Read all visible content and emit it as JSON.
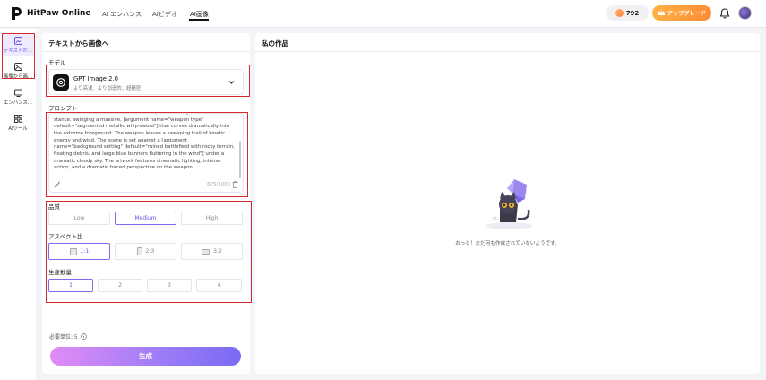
{
  "header": {
    "brand": "HitPaw Online",
    "tabs": [
      {
        "label": "AI エンハンス"
      },
      {
        "label": "AIビデオ"
      },
      {
        "label": "AI画像"
      }
    ],
    "credits": "792",
    "upgrade_label": "アップグレード"
  },
  "rail": {
    "items": [
      {
        "label": "テキストか...",
        "icon": "text-to-image-icon"
      },
      {
        "label": "画像から画...",
        "icon": "image-to-image-icon"
      },
      {
        "label": "エンハンス...",
        "icon": "enhance-icon"
      },
      {
        "label": "AIツール",
        "icon": "ai-tools-icon"
      }
    ]
  },
  "panel": {
    "title": "テキストから画像へ",
    "model_label": "モデル",
    "model": {
      "name": "GPT Image 2.0",
      "desc": "より高速、より創造的、超精密"
    },
    "prompt_label": "プロンプト",
    "prompt_text": "default=\"blue and white\"] tunic. She is captured in a dynamic combat\nstance, swinging a massive, [argument name=\"weapon type\"\ndefault=\"segmented metallic whip-sword\"] that curves dramatically into\nthe extreme foreground. The weapon leaves a sweeping trail of kinetic\nenergy and wind. The scene is set against a [argument\nname=\"background setting\" default=\"ruined battlefield with rocky terrain,\nfloating debris, and large blue banners fluttering in the wind\"] under a\ndramatic cloudy sky. The artwork features cinematic lighting, intense\naction, and a dramatic forced perspective on the weapon.",
    "prompt_counter": "675/2000",
    "quality_label": "品質",
    "quality_options": [
      "Low",
      "Medium",
      "High"
    ],
    "quality_selected": "Medium",
    "aspect_label": "アスペクト比",
    "aspect_options": [
      "1:1",
      "2:3",
      "3:2"
    ],
    "aspect_selected": "1:1",
    "count_label": "生産数量",
    "count_options": [
      "1",
      "2",
      "3",
      "4"
    ],
    "count_selected": "1",
    "units_label": "必要単位: 5",
    "generate_label": "生成"
  },
  "works": {
    "title": "私の作品",
    "empty_text": "おっと！まだ何も作成されていないようです。"
  },
  "colors": {
    "accent": "#6a55e6",
    "upgrade": "#ff9a3c",
    "highlight_box": "#d9272e"
  }
}
